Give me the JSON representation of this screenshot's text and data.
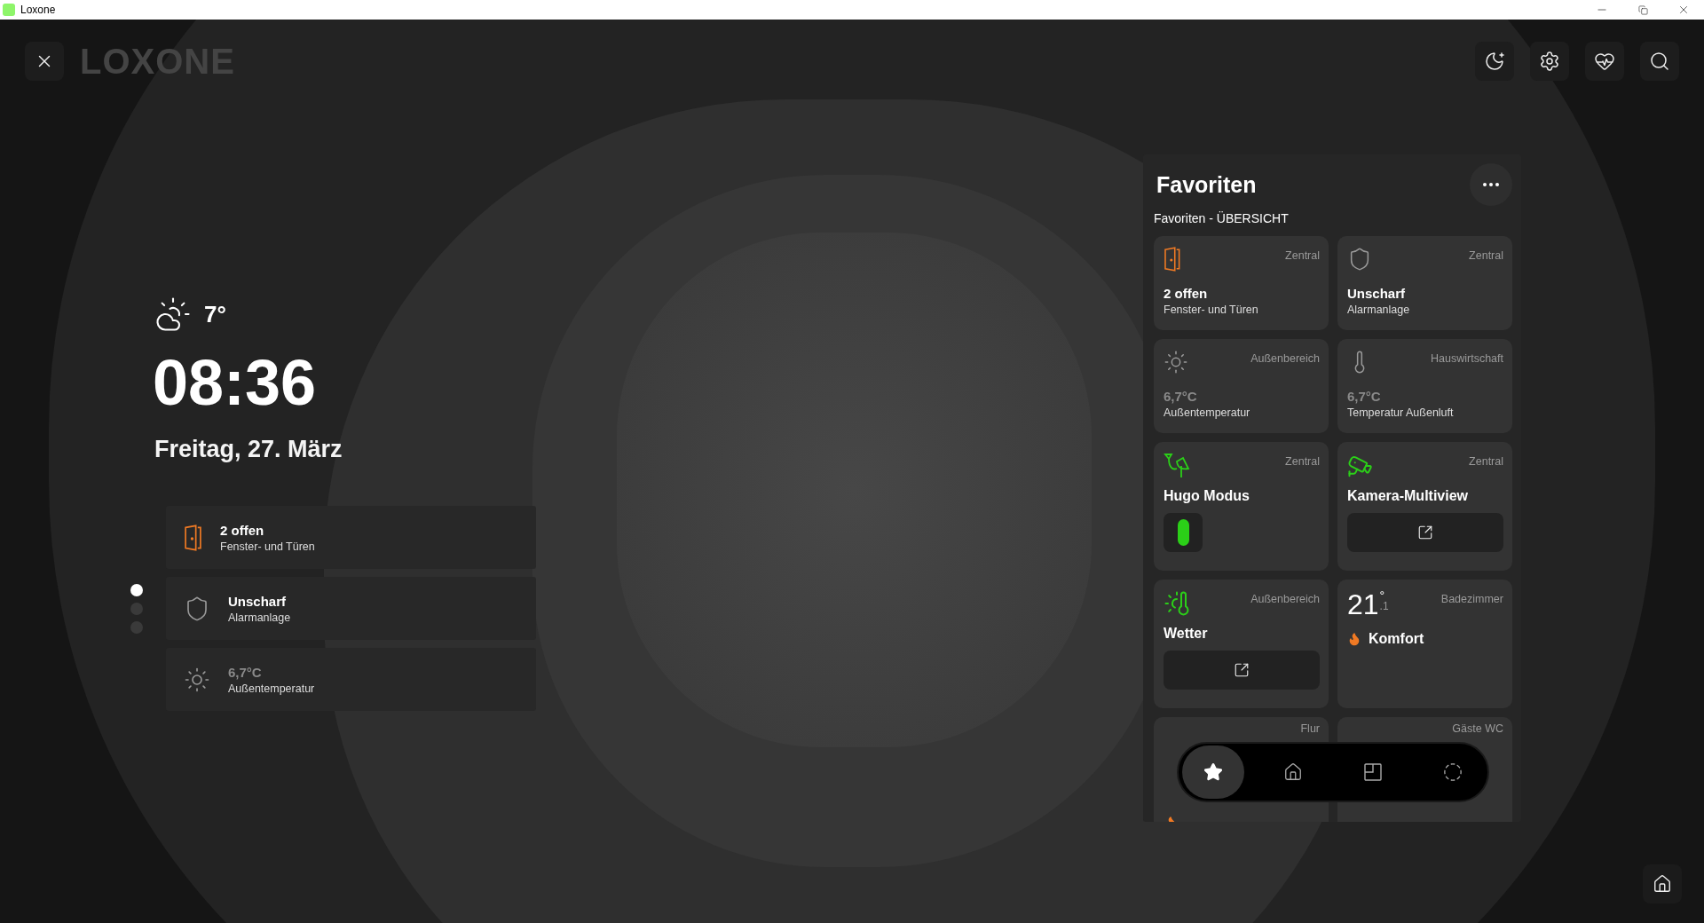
{
  "window": {
    "title": "Loxone"
  },
  "topbar": {
    "logo": "LOXONE"
  },
  "weather": {
    "temperature": "7°"
  },
  "clock": {
    "time": "08:36",
    "date": "Freitag, 27. März"
  },
  "status_cards": [
    {
      "kind": "door",
      "value": "2 offen",
      "label": "Fenster- und Türen",
      "dimmed": false
    },
    {
      "kind": "shield",
      "value": "Unscharf",
      "label": "Alarmanlage",
      "dimmed": false
    },
    {
      "kind": "sun",
      "value": "6,7°C",
      "label": "Außentemperatur",
      "dimmed": true
    }
  ],
  "pager": [
    {
      "selected": true
    },
    {
      "selected": false
    },
    {
      "selected": false
    }
  ],
  "favorites": {
    "title": "Favoriten",
    "subtitle": "Favoriten - ÜBERSICHT",
    "tiles": [
      {
        "kind": "status",
        "room": "Zentral",
        "value": "2 offen",
        "label": "Fenster- und Türen",
        "dimmed": false
      },
      {
        "kind": "status",
        "room": "Zentral",
        "value": "Unscharf",
        "label": "Alarmanlage",
        "dimmed": false
      },
      {
        "kind": "status",
        "room": "Außenbereich",
        "value": "6,7°C",
        "label": "Außentemperatur",
        "dimmed": true
      },
      {
        "kind": "status",
        "room": "Hauswirtschaft",
        "value": "6,7°C",
        "label": "Temperatur Außenluft",
        "dimmed": true
      },
      {
        "kind": "switch",
        "room": "Zentral",
        "title": "Hugo Modus",
        "on": true
      },
      {
        "kind": "link",
        "room": "Zentral",
        "title": "Kamera-Multiview"
      },
      {
        "kind": "link",
        "room": "Außenbereich",
        "title": "Wetter"
      },
      {
        "kind": "climate",
        "room": "Badezimmer",
        "temperature": "21",
        "unit": "°",
        "decimal": ".1",
        "mode": "Komfort"
      },
      {
        "kind": "cut",
        "room": "Flur",
        "flame": true
      },
      {
        "kind": "cut",
        "room": "Gäste WC",
        "flame": false
      }
    ]
  },
  "nav": [
    {
      "kind": "star",
      "selected": true
    },
    {
      "kind": "home",
      "selected": false
    },
    {
      "kind": "rooms",
      "selected": false
    },
    {
      "kind": "scenes",
      "selected": false
    }
  ]
}
